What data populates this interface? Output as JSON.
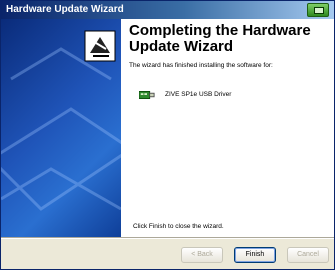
{
  "window": {
    "title": "Hardware Update Wizard"
  },
  "wizard": {
    "heading": "Completing the Hardware Update Wizard",
    "description": "The wizard has finished installing the software for:",
    "device_name": "ZIVE SP1e USB Driver",
    "finish_hint": "Click Finish to close the wizard."
  },
  "buttons": {
    "back": "< Back",
    "finish": "Finish",
    "cancel": "Cancel"
  },
  "icons": [
    "help-icon",
    "usb-driver-icon",
    "hardware-wizard-icon"
  ]
}
